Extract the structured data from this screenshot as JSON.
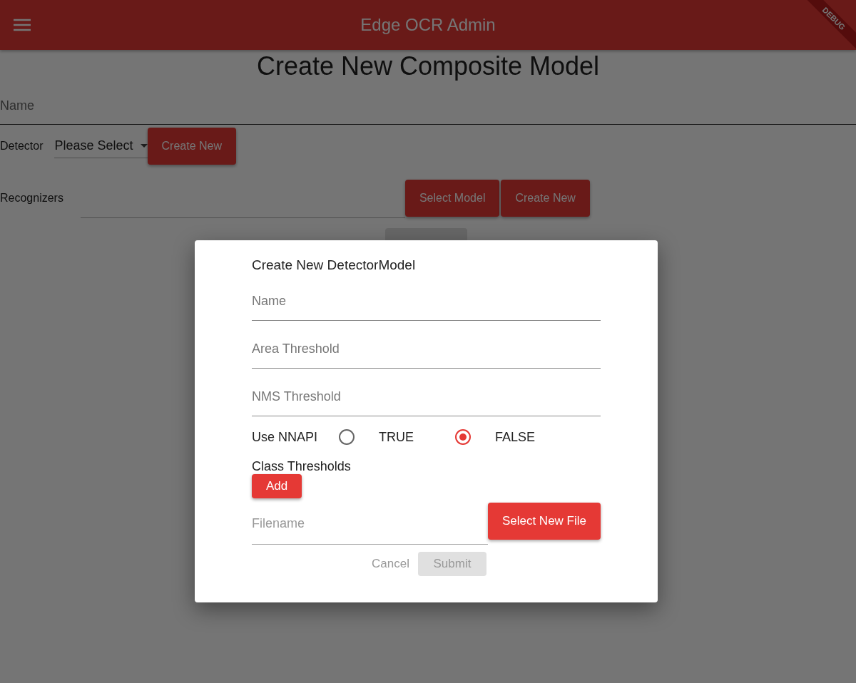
{
  "app_bar": {
    "title": "Edge OCR Admin",
    "debug_banner": "DEBUG"
  },
  "page": {
    "heading": "Create New Composite Model",
    "name_field": {
      "placeholder": "Name"
    },
    "detector": {
      "label": "Detector",
      "dropdown": "Please Select",
      "button": "Create New"
    },
    "recognizers": {
      "label": "Recognizers",
      "buttons": [
        "Select Model",
        "Create New"
      ]
    }
  },
  "dialog": {
    "title": "Create New DetectorModel",
    "fields": [
      {
        "placeholder": "Name"
      },
      {
        "placeholder": "Area Threshold"
      },
      {
        "placeholder": "NMS Threshold"
      }
    ],
    "nnapi": {
      "label": "Use NNAPI",
      "options": [
        {
          "label": "TRUE",
          "selected": false
        },
        {
          "label": "FALSE",
          "selected": true
        }
      ]
    },
    "class_thresholds": {
      "label": "Class Thresholds",
      "button": "Add"
    },
    "file": {
      "placeholder": "Filename",
      "button": "Select New File"
    },
    "actions": [
      {
        "label": "Cancel",
        "kind": "text",
        "disabled": true
      },
      {
        "label": "Submit",
        "kind": "filled",
        "disabled": true
      }
    ]
  }
}
